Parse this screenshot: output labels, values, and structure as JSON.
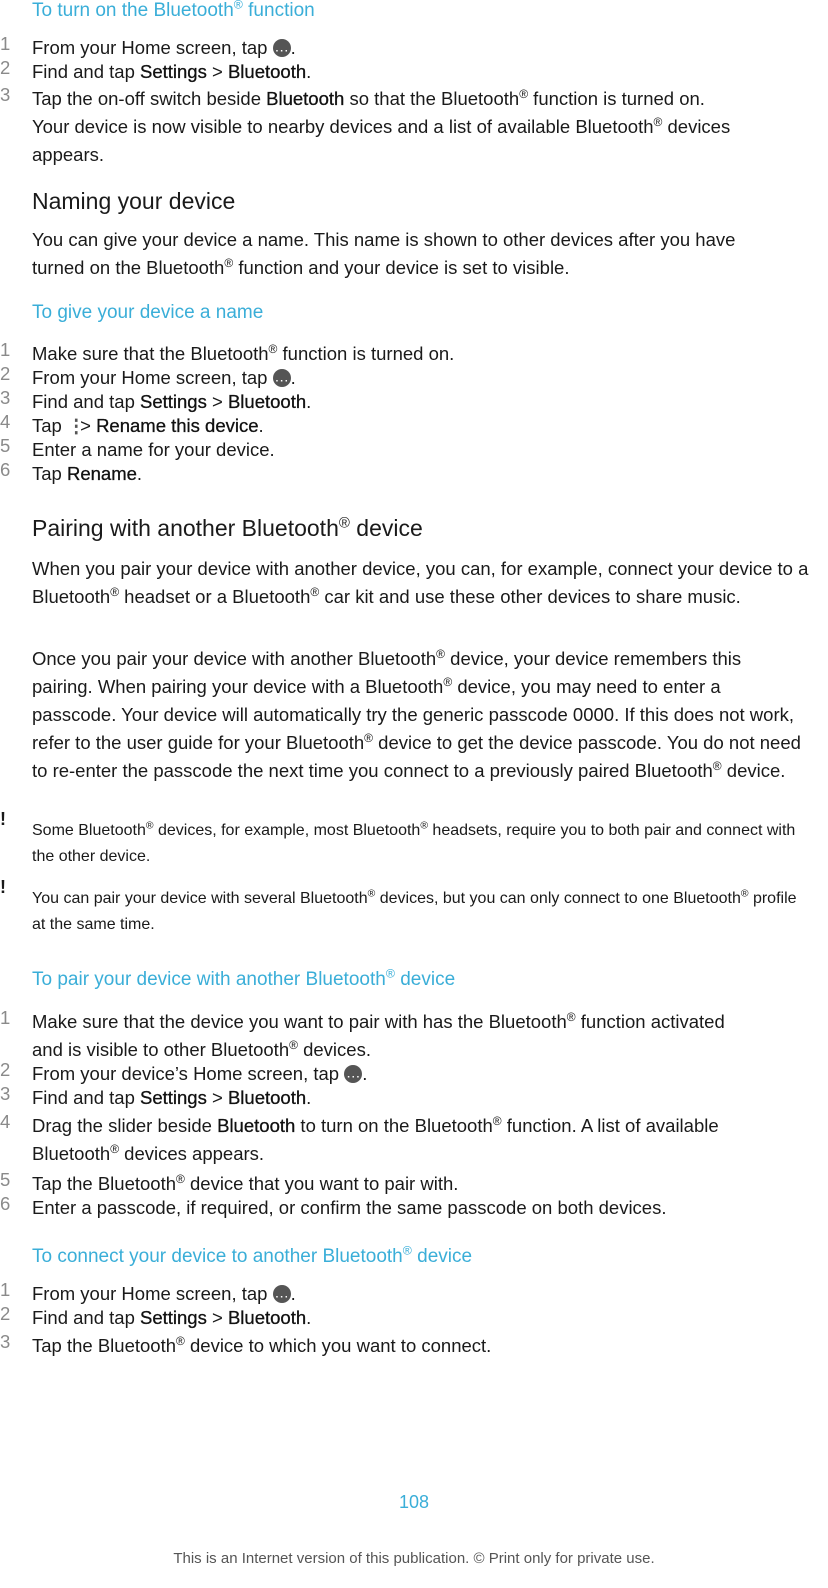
{
  "sections": {
    "turn_on": {
      "heading": "To turn on the Bluetooth® function",
      "steps": [
        {
          "num": "1",
          "pre": "From your Home screen, tap ",
          "post": "."
        },
        {
          "num": "2",
          "pre": "Find and tap ",
          "b1": "Settings",
          "mid": " > ",
          "b2": "Bluetooth",
          "post": "."
        },
        {
          "num": "3",
          "pre": "Tap the on-off switch beside ",
          "b1": "Bluetooth",
          "post": " so that the Bluetooth® function is turned on. Your device is now visible to nearby devices and a list of available Bluetooth® devices appears."
        }
      ]
    },
    "naming": {
      "title": "Naming your device",
      "body": "You can give your device a name. This name is shown to other devices after you have turned on the Bluetooth® function and your device is set to visible."
    },
    "give_name": {
      "heading": "To give your device a name",
      "steps": [
        {
          "num": "1",
          "text": "Make sure that the Bluetooth® function is turned on."
        },
        {
          "num": "2",
          "pre": "From your Home screen, tap ",
          "post": "."
        },
        {
          "num": "3",
          "pre": "Find and tap ",
          "b1": "Settings",
          "mid": " > ",
          "b2": "Bluetooth",
          "post": "."
        },
        {
          "num": "4",
          "pre": "Tap ",
          "mid": " > ",
          "b1": "Rename this device",
          "post": "."
        },
        {
          "num": "5",
          "text": "Enter a name for your device."
        },
        {
          "num": "6",
          "pre": "Tap ",
          "b1": "Rename",
          "post": "."
        }
      ]
    },
    "pairing": {
      "title": "Pairing with another Bluetooth® device",
      "body1": "When you pair your device with another device, you can, for example, connect your device to a Bluetooth® headset or a Bluetooth® car kit and use these other devices to share music.",
      "body2": "Once you pair your device with another Bluetooth® device, your device remembers this pairing. When pairing your device with a Bluetooth® device, you may need to enter a passcode. Your device will automatically try the generic passcode 0000. If this does not work, refer to the user guide for your Bluetooth® device to get the device passcode. You do not need to re-enter the passcode the next time you connect to a previously paired Bluetooth® device.",
      "note1": "Some Bluetooth® devices, for example, most Bluetooth® headsets, require you to both pair and connect with the other device.",
      "note2": "You can pair your device with several Bluetooth® devices, but you can only connect to one Bluetooth® profile at the same time.",
      "note_icon": "!"
    },
    "pair": {
      "heading": "To pair your device with another Bluetooth® device",
      "steps": [
        {
          "num": "1",
          "text": "Make sure that the device you want to pair with has the Bluetooth® function activated and is visible to other Bluetooth® devices."
        },
        {
          "num": "2",
          "pre": "From your device’s Home screen, tap ",
          "post": "."
        },
        {
          "num": "3",
          "pre": "Find and tap ",
          "b1": "Settings",
          "mid": " > ",
          "b2": "Bluetooth",
          "post": "."
        },
        {
          "num": "4",
          "pre": "Drag the slider beside ",
          "b1": "Bluetooth",
          "post": " to turn on the Bluetooth® function. A list of available Bluetooth® devices appears."
        },
        {
          "num": "5",
          "text": "Tap the Bluetooth® device that you want to pair with."
        },
        {
          "num": "6",
          "text": "Enter a passcode, if required, or confirm the same passcode on both devices."
        }
      ]
    },
    "connect": {
      "heading": "To connect your device to another Bluetooth® device",
      "steps": [
        {
          "num": "1",
          "pre": "From your Home screen, tap ",
          "post": "."
        },
        {
          "num": "2",
          "pre": "Find and tap ",
          "b1": "Settings",
          "mid": " > ",
          "b2": "Bluetooth",
          "post": "."
        },
        {
          "num": "3",
          "text": "Tap the Bluetooth® device to which you want to connect."
        }
      ]
    }
  },
  "footer": {
    "page_number": "108",
    "notice": "This is an Internet version of this publication. © Print only for private use."
  },
  "colors": {
    "accent": "#3aaed8",
    "text": "#1a1a1a",
    "step_number": "#8a8a8a"
  }
}
